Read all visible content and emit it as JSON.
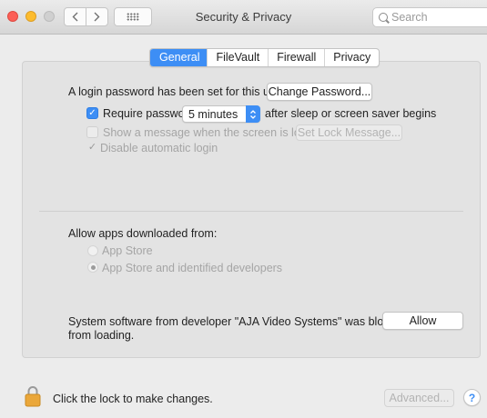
{
  "window": {
    "title": "Security & Privacy",
    "search_placeholder": "Search"
  },
  "tabs": [
    "General",
    "FileVault",
    "Firewall",
    "Privacy"
  ],
  "general": {
    "login_text": "A login password has been set for this user",
    "change_password_label": "Change Password...",
    "require_password_label": "Require password",
    "require_password_checked": true,
    "require_password_value": "5 minutes",
    "after_sleep_text": "after sleep or screen saver begins",
    "show_message_label": "Show a message when the screen is locked",
    "show_message_checked": false,
    "set_lock_message_label": "Set Lock Message...",
    "disable_autologin_label": "Disable automatic login",
    "disable_autologin_checked": true
  },
  "downloads": {
    "heading": "Allow apps downloaded from:",
    "options": [
      "App Store",
      "App Store and identified developers"
    ],
    "selected": "App Store and identified developers"
  },
  "blocked": {
    "line1": "System software from developer \"AJA Video Systems\" was blocked",
    "line2": "from loading.",
    "allow_label": "Allow"
  },
  "footer": {
    "lock_text": "Click the lock to make changes.",
    "advanced_label": "Advanced...",
    "help_label": "?"
  },
  "colors": {
    "accent": "#3d8ef5",
    "close": "#fc5f57",
    "minimize": "#fdbc2e",
    "lock": "#e8a93a"
  }
}
